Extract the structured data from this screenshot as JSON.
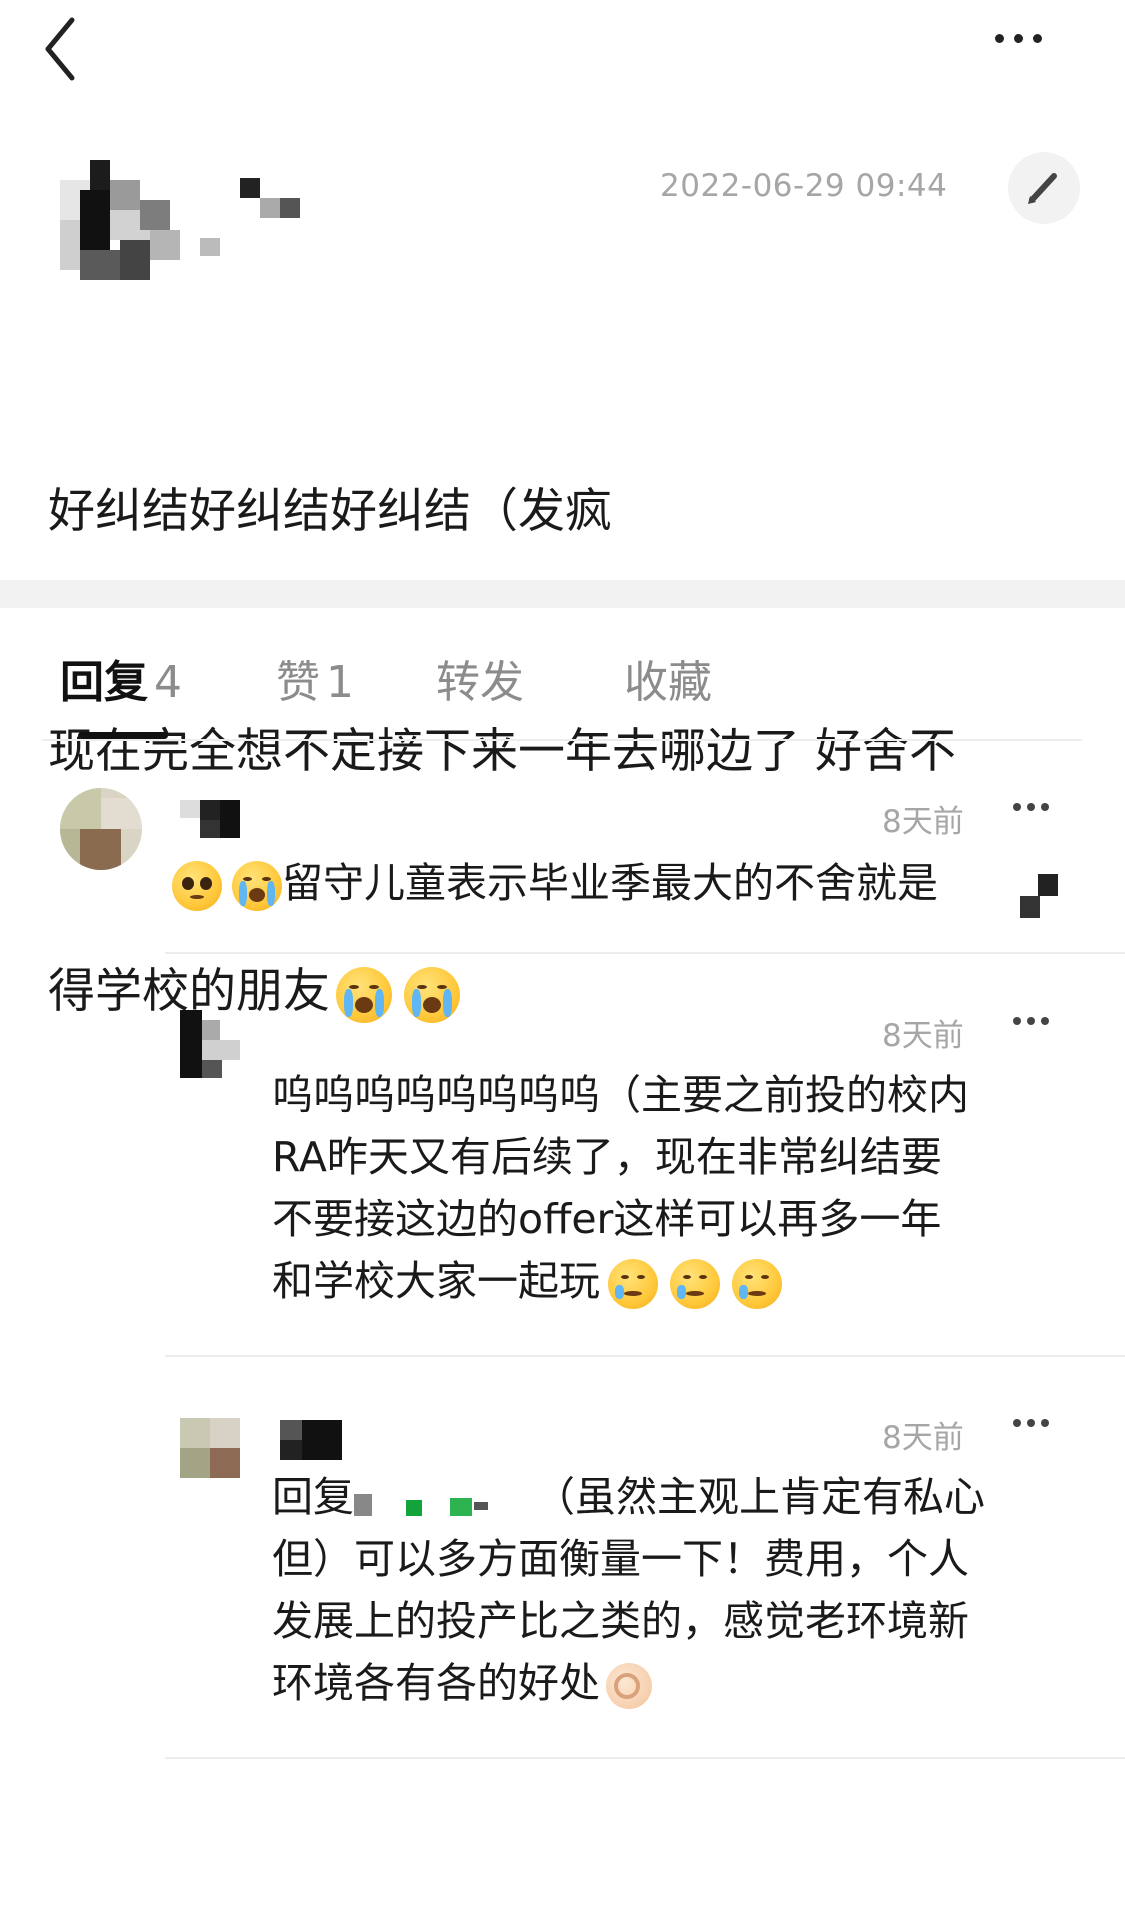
{
  "topbar": {
    "back_icon": "chevron-left-icon",
    "more_icon": "more-horizontal-icon"
  },
  "post": {
    "timestamp": "2022-06-29 09:44",
    "edit_icon": "pencil-icon",
    "lines": [
      "好纠结好纠结好纠结（发疯",
      "现在完全想不定接下来一年去哪边了 好舍不",
      "得学校的朋友"
    ],
    "emojis": [
      "loudly-crying-emoji",
      "loudly-crying-emoji"
    ]
  },
  "tabs": [
    {
      "label": "回复",
      "count": "4",
      "active": true
    },
    {
      "label": "赞",
      "count": "1"
    },
    {
      "label": "转发",
      "count": ""
    },
    {
      "label": "收藏",
      "count": ""
    }
  ],
  "comments": [
    {
      "time": "8天前",
      "text": "留守儿童表示毕业季最大的不舍就是",
      "leading_emojis": [
        "pleading-face-emoji",
        "loudly-crying-emoji"
      ]
    },
    {
      "time": "8天前",
      "text": "呜呜呜呜呜呜呜呜（主要之前投的校内\nRA昨天又有后续了，现在非常纠结要\n不要接这边的offer这样可以再多一年\n和学校大家一起玩",
      "trailing_emojis": [
        "smiling-with-tear-emoji",
        "smiling-with-tear-emoji",
        "smiling-with-tear-emoji"
      ]
    },
    {
      "time": "8天前",
      "reply_prefix": "回复",
      "text_line1": "（虽然主观上肯定有私心",
      "text_rest": "但）可以多方面衡量一下！费用，个人\n发展上的投产比之类的，感觉老环境新\n环境各有各的好处",
      "trailing_emojis": [
        "ok-hand-emoji"
      ]
    }
  ],
  "colors": {
    "meta_gray": "#a6a6a6",
    "separator": "#f2f2f2",
    "text": "#1a1a1a"
  }
}
